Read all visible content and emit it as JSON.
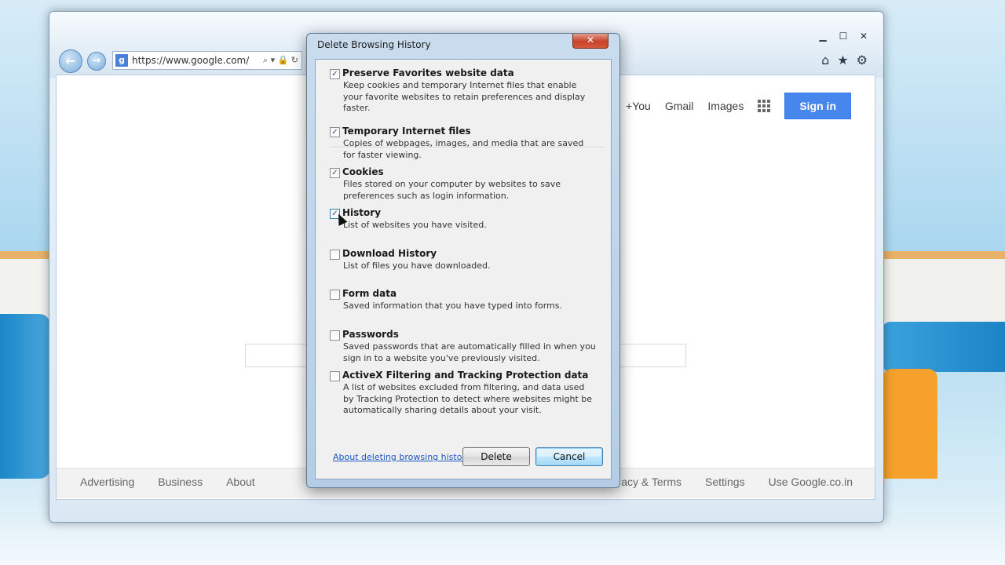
{
  "browser": {
    "address": "https://www.google.com/",
    "caption_buttons": {
      "minimize": "▁",
      "maximize": "☐",
      "close": "✕"
    },
    "toolbar_icons": {
      "home": "⌂",
      "favorites": "★",
      "tools": "⚙"
    },
    "nav": {
      "back": "←",
      "forward": "→"
    },
    "address_icons": "⌕ ▾ 🔒 ↻"
  },
  "google": {
    "top_links": [
      "+You",
      "Gmail",
      "Images"
    ],
    "sign_in": "Sign in",
    "footer_left": [
      "Advertising",
      "Business",
      "About"
    ],
    "footer_right": [
      "acy & Terms",
      "Settings",
      "Use Google.co.in"
    ]
  },
  "dialog": {
    "title": "Delete Browsing History",
    "close_glyph": "✕",
    "options": [
      {
        "title": "Preserve Favorites website data",
        "desc": "Keep cookies and temporary Internet files that enable your favorite websites to retain preferences and display faster.",
        "checked": true
      },
      {
        "title": "Temporary Internet files",
        "desc": "Copies of webpages, images, and media that are saved for faster viewing.",
        "checked": true
      },
      {
        "title": "Cookies",
        "desc": "Files stored on your computer by websites to save preferences such as login information.",
        "checked": true
      },
      {
        "title": "History",
        "desc": "List of websites you have visited.",
        "checked": true
      },
      {
        "title": "Download History",
        "desc": "List of files you have downloaded.",
        "checked": false
      },
      {
        "title": "Form data",
        "desc": "Saved information that you have typed into forms.",
        "checked": false
      },
      {
        "title": "Passwords",
        "desc": "Saved passwords that are automatically filled in when you sign in to a website you've previously visited.",
        "checked": false
      },
      {
        "title": "ActiveX Filtering and Tracking Protection data",
        "desc": "A list of websites excluded from filtering, and data used by Tracking Protection to detect where websites might be automatically sharing details about your visit.",
        "checked": false
      }
    ],
    "about_link": "About deleting browsing history",
    "delete_label": "Delete",
    "cancel_label": "Cancel",
    "check_glyph": "✓"
  }
}
